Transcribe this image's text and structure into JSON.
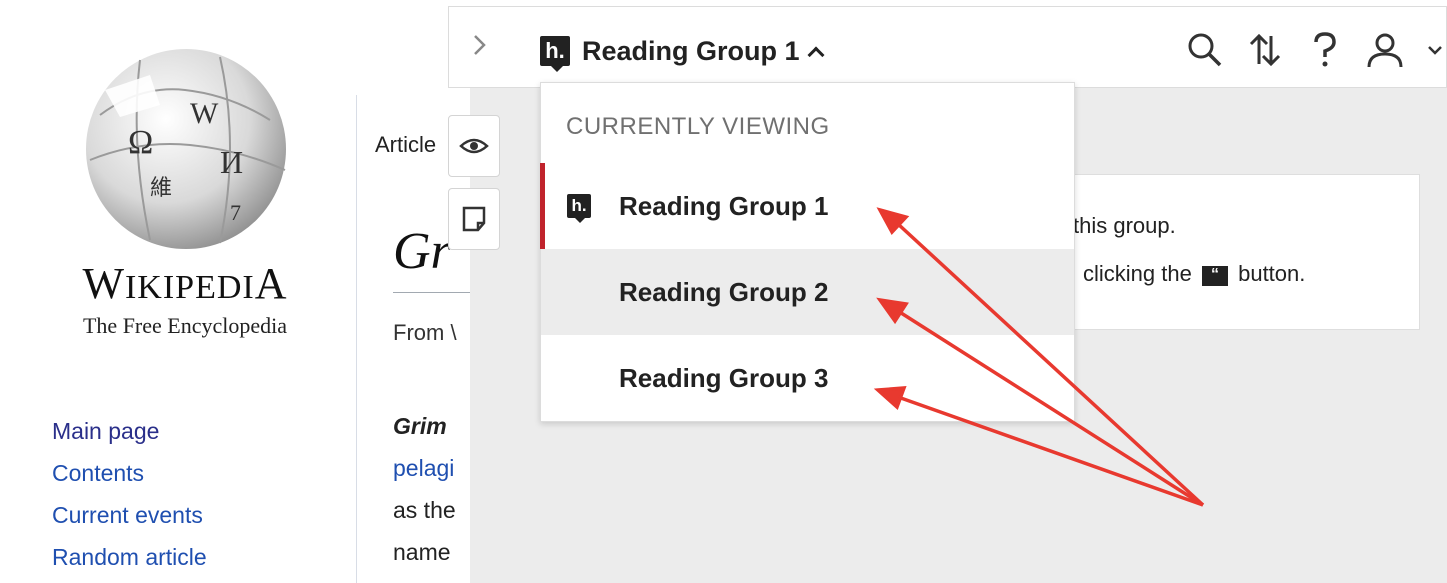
{
  "wikipedia": {
    "wordmark_w": "W",
    "wordmark_rest": "IKIPEDI",
    "wordmark_a": "A",
    "tagline": "The Free Encyclopedia",
    "nav": [
      "Main page",
      "Contents",
      "Current events",
      "Random article"
    ]
  },
  "article": {
    "tab": "Article",
    "title_fragment": "Gr",
    "from_fragment": "From \\",
    "lines": [
      "Grim",
      "pelagi",
      "as the",
      "name"
    ]
  },
  "hypothesis": {
    "toggle_icon": "chevron-right-icon",
    "current_group": "Reading Group 1",
    "dropdown": {
      "heading": "CURRENTLY VIEWING",
      "items": [
        {
          "label": "Reading Group 1",
          "state": "active"
        },
        {
          "label": "Reading Group 2",
          "state": "hover"
        },
        {
          "label": "Reading Group 3",
          "state": "default"
        }
      ]
    },
    "card": {
      "line1": "this group.",
      "line2_before": "clicking the",
      "line2_after": "button."
    },
    "icons": [
      "search-icon",
      "sort-icon",
      "help-icon",
      "user-icon",
      "chevron-down-icon"
    ],
    "accent_color": "#c0232c"
  }
}
